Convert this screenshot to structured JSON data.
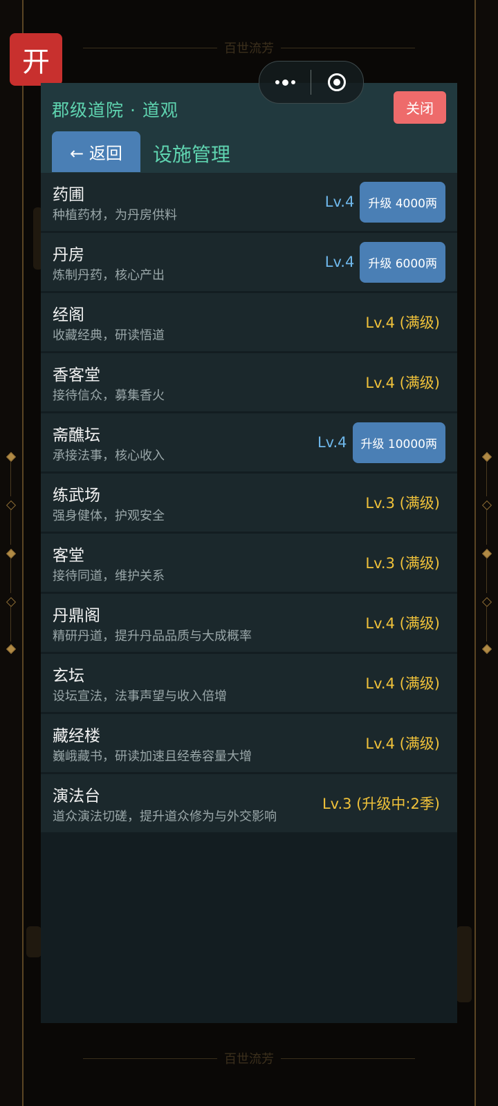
{
  "background": {
    "banner_text": "百世流芳"
  },
  "open_button": {
    "label": "开"
  },
  "header": {
    "title": "郡级道院 · 道观",
    "close_label": "关闭",
    "back_label": "← 返回",
    "section_title": "设施管理"
  },
  "facilities": [
    {
      "name": "药圃",
      "desc": "种植药材，为丹房供料",
      "level": "Lv.4",
      "action": "升级 4000两"
    },
    {
      "name": "丹房",
      "desc": "炼制丹药，核心产出",
      "level": "Lv.4",
      "action": "升级 6000两"
    },
    {
      "name": "经阁",
      "desc": "收藏经典，研读悟道",
      "level": "Lv.4 (满级)"
    },
    {
      "name": "香客堂",
      "desc": "接待信众，募集香火",
      "level": "Lv.4 (满级)"
    },
    {
      "name": "斋醮坛",
      "desc": "承接法事，核心收入",
      "level": "Lv.4",
      "action": "升级 10000两"
    },
    {
      "name": "练武场",
      "desc": "强身健体，护观安全",
      "level": "Lv.3 (满级)"
    },
    {
      "name": "客堂",
      "desc": "接待同道，维护关系",
      "level": "Lv.3 (满级)"
    },
    {
      "name": "丹鼎阁",
      "desc": "精研丹道，提升丹品品质与大成概率",
      "level": "Lv.4 (满级)"
    },
    {
      "name": "玄坛",
      "desc": "设坛宣法，法事声望与收入倍增",
      "level": "Lv.4 (满级)"
    },
    {
      "name": "藏经楼",
      "desc": "巍峨藏书，研读加速且经卷容量大增",
      "level": "Lv.4 (满级)"
    },
    {
      "name": "演法台",
      "desc": "道众演法切磋，提升道众修为与外交影响",
      "level": "Lv.3 (升级中:2季)"
    }
  ],
  "colors": {
    "accent_teal": "#5fd4b0",
    "button_blue": "#4a7fb5",
    "close_red": "#ee6b6b",
    "level_blue": "#6fb8ec",
    "level_gold": "#f0c23a"
  }
}
